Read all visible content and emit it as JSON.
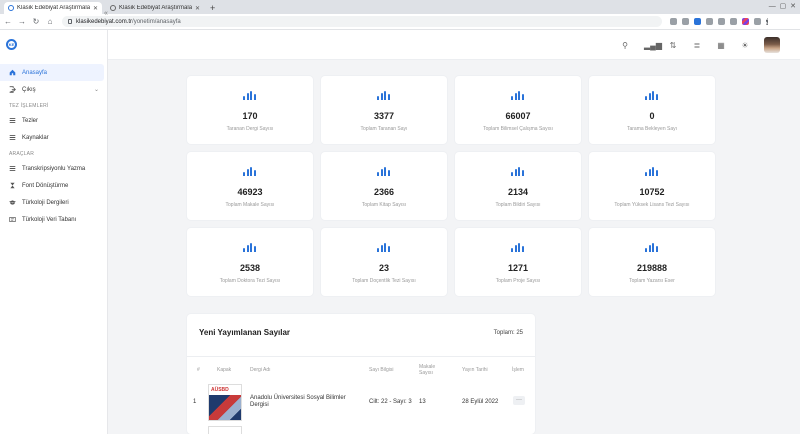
{
  "browser": {
    "tabs": [
      {
        "title": "Klasik Edebiyat Araştırmaları",
        "active": true
      },
      {
        "title": "Klasik Edebiyat Araştırmaları",
        "active": false
      }
    ],
    "url_host": "klasikedebiyat.com.tr",
    "url_path": "/yonetim/anasayfa"
  },
  "sidebar": {
    "logo_text": "KE",
    "items_main": [
      {
        "label": "Anasayfa",
        "icon": "home-icon"
      },
      {
        "label": "Çıkış",
        "icon": "logout-icon"
      }
    ],
    "section1": "TEZ İŞLEMLERİ",
    "items_tez": [
      {
        "label": "Tezler",
        "icon": "list-icon"
      },
      {
        "label": "Kaynaklar",
        "icon": "list-icon"
      }
    ],
    "section2": "ARAÇLAR",
    "items_tools": [
      {
        "label": "Transkripsiyonlu Yazma",
        "icon": "list-icon"
      },
      {
        "label": "Font Dönüştürme",
        "icon": "hourglass-icon"
      },
      {
        "label": "Türkoloji Dergileri",
        "icon": "graduation-cap-icon"
      },
      {
        "label": "Türkoloji Veri Tabanı",
        "icon": "id-card-icon"
      }
    ]
  },
  "stats": [
    {
      "value": "170",
      "label": "Taranan Dergi Sayısı"
    },
    {
      "value": "3377",
      "label": "Toplam Taranan Sayı"
    },
    {
      "value": "66007",
      "label": "Toplam Bilimsel Çalışma Sayısı"
    },
    {
      "value": "0",
      "label": "Tarama Bekleyen Sayı"
    },
    {
      "value": "46923",
      "label": "Toplam Makale Sayısı"
    },
    {
      "value": "2366",
      "label": "Toplam Kitap Sayısı"
    },
    {
      "value": "2134",
      "label": "Toplam Bildiri Sayısı"
    },
    {
      "value": "10752",
      "label": "Toplam Yüksek Lisans Tezi Sayısı"
    },
    {
      "value": "2538",
      "label": "Toplam Doktora Tezi Sayısı"
    },
    {
      "value": "23",
      "label": "Toplam Doçentlik Tezi Sayısı"
    },
    {
      "value": "1271",
      "label": "Toplam Proje Sayısı"
    },
    {
      "value": "219888",
      "label": "Toplam Yazarsı Eser"
    }
  ],
  "pubs": {
    "title": "Yeni Yayımlanan Sayılar",
    "total": "Toplam: 25",
    "headers": {
      "num": "#",
      "cover": "Kapak",
      "journal": "Dergi Adı",
      "issue": "Sayı Bilgisi",
      "articles": "Makale Sayısı",
      "date": "Yayın Tarihi",
      "action": "İşlem"
    },
    "rows": [
      {
        "num": "1",
        "cover_text": "AÜSBD",
        "journal": "Anadolu Üniversitesi Sosyal Bilimler Dergisi",
        "issue": "Cilt: 22 - Sayı: 3",
        "articles": "13",
        "date": "28 Eylül 2022",
        "action": "···"
      }
    ]
  },
  "colors": {
    "accent": "#2a73d9",
    "background": "#f3f4f6"
  }
}
